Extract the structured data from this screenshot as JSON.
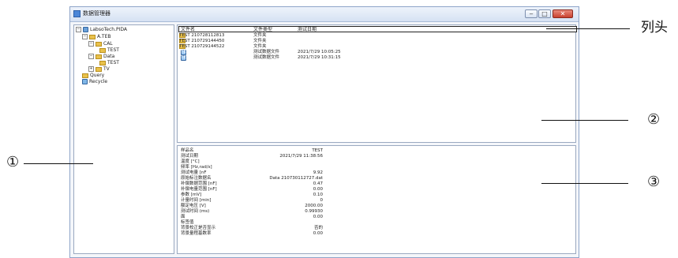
{
  "window": {
    "title": "数据管理器",
    "min_label": "‒",
    "max_label": "□",
    "close_label": "✕"
  },
  "tree": [
    {
      "label": "LabsoTech.PIDA",
      "icon": "database-icon",
      "exp": "−"
    },
    {
      "label": "A.TEB",
      "icon": "folder-icon",
      "exp": "−"
    },
    {
      "label": "CAL",
      "icon": "folder-icon",
      "exp": "−"
    },
    {
      "label": "TEST",
      "icon": "folder-icon",
      "exp": ""
    },
    {
      "label": "Data",
      "icon": "folder-icon",
      "exp": "−"
    },
    {
      "label": "TEST",
      "icon": "folder-icon",
      "exp": ""
    },
    {
      "label": "TV",
      "icon": "folder-icon",
      "exp": "+"
    },
    {
      "label": "Query",
      "icon": "folder-icon",
      "exp": ""
    },
    {
      "label": "Recycle",
      "icon": "recycle-icon",
      "exp": ""
    }
  ],
  "list": {
    "headers": [
      "文件名",
      "文件类型",
      "测试日期"
    ],
    "rows": [
      {
        "name": "TEST 210728112813",
        "type": "文件夹",
        "date": "",
        "selected": false
      },
      {
        "name": "TEST 210729144450",
        "type": "文件夹",
        "date": "",
        "selected": false
      },
      {
        "name": "TEST 210729144522",
        "type": "文件夹",
        "date": "",
        "selected": false
      },
      {
        "name": "TEST 210730111825.dat",
        "type": "测试数据文件",
        "date": "2021/7/29 10:05:25",
        "selected": true
      },
      {
        "name": "TEST 210730112119.dat",
        "type": "测试数据文件",
        "date": "2021/7/29 10:31:15",
        "selected": true
      }
    ]
  },
  "props": [
    {
      "k": "样品名",
      "v": "TEST"
    },
    {
      "k": "测试日期",
      "v": "2021/7/29 11:38:56"
    },
    {
      "k": "温度 [°C]",
      "v": ""
    },
    {
      "k": "频率 [Hz,rad/s]",
      "v": ""
    },
    {
      "k": "测试电量 [nF",
      "v": "9.92"
    },
    {
      "k": "原始标注数据名",
      "v": "Data 210730112727.dat"
    },
    {
      "k": "补偿数据范围 [nF]",
      "v": "0.47"
    },
    {
      "k": "补偿电量范围 [nF]",
      "v": "0.00"
    },
    {
      "k": "参数 [mV]",
      "v": "0.10"
    },
    {
      "k": "计量时间 [min]",
      "v": "0"
    },
    {
      "k": "额定电压 [V]",
      "v": "2000.00"
    },
    {
      "k": "测试时间 (ms)",
      "v": "0.99930"
    },
    {
      "k": "面",
      "v": "0.00"
    },
    {
      "k": "标签值",
      "v": ""
    },
    {
      "k": "背景校正是否显示",
      "v": "否的"
    },
    {
      "k": "背景量程基数率",
      "v": "0.00"
    }
  ],
  "annotations": {
    "columns_label": "列头",
    "n1": "①",
    "n2": "②",
    "n3": "③"
  }
}
